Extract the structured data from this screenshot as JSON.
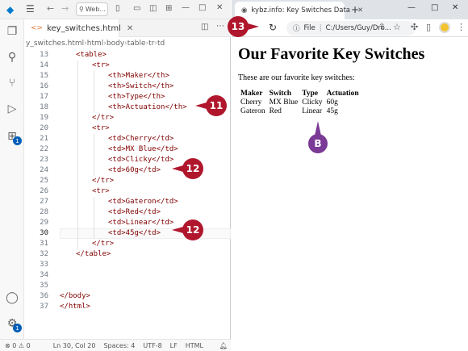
{
  "vscode": {
    "search_text": "Web...",
    "tab_label": "key_switches.html",
    "breadcrumb": [
      "y_switches.html",
      "html",
      "body",
      "table",
      "tr",
      "td"
    ],
    "lines": [
      {
        "n": "13",
        "text": "<table>",
        "indent": 1
      },
      {
        "n": "14",
        "text": "<tr>",
        "indent": 2
      },
      {
        "n": "15",
        "text": "<th>Maker</th>",
        "indent": 3
      },
      {
        "n": "16",
        "text": "<th>Switch</th>",
        "indent": 3
      },
      {
        "n": "17",
        "text": "<th>Type</th>",
        "indent": 3
      },
      {
        "n": "18",
        "text": "<th>Actuation</th>",
        "indent": 3
      },
      {
        "n": "19",
        "text": "</tr>",
        "indent": 2
      },
      {
        "n": "20",
        "text": "<tr>",
        "indent": 2
      },
      {
        "n": "21",
        "text": "<td>Cherry</td>",
        "indent": 3
      },
      {
        "n": "22",
        "text": "<td>MX Blue</td>",
        "indent": 3
      },
      {
        "n": "23",
        "text": "<td>Clicky</td>",
        "indent": 3
      },
      {
        "n": "24",
        "text": "<td>60g</td>",
        "indent": 3
      },
      {
        "n": "25",
        "text": "</tr>",
        "indent": 2
      },
      {
        "n": "26",
        "text": "<tr>",
        "indent": 2
      },
      {
        "n": "27",
        "text": "<td>Gateron</td>",
        "indent": 3
      },
      {
        "n": "28",
        "text": "<td>Red</td>",
        "indent": 3
      },
      {
        "n": "29",
        "text": "<td>Linear</td>",
        "indent": 3
      },
      {
        "n": "30",
        "text": "<td>45g</td>",
        "indent": 3
      },
      {
        "n": "31",
        "text": "</tr>",
        "indent": 2
      },
      {
        "n": "32",
        "text": "</table>",
        "indent": 1
      },
      {
        "n": "33",
        "text": "",
        "indent": 0
      },
      {
        "n": "34",
        "text": "",
        "indent": 0
      },
      {
        "n": "35",
        "text": "",
        "indent": 0
      },
      {
        "n": "36",
        "text": "</body>",
        "indent": 0
      },
      {
        "n": "37",
        "text": "</html>",
        "indent": 0
      }
    ],
    "status": {
      "errors": "0",
      "warnings": "0",
      "position": "Ln 30, Col 20",
      "spaces": "Spaces: 4",
      "encoding": "UTF-8",
      "eol": "LF",
      "language": "HTML"
    },
    "account_badge": "1",
    "extensions_badge": "1"
  },
  "browser": {
    "tab_title": "kybz.info: Key Switches Data",
    "address_prefix": "File",
    "address": "C:/Users/Guy/Dro...",
    "page": {
      "heading": "Our Favorite Key Switches",
      "intro": "These are our favorite key switches:",
      "table": {
        "headers": [
          "Maker",
          "Switch",
          "Type",
          "Actuation"
        ],
        "rows": [
          [
            "Cherry",
            "MX Blue",
            "Clicky",
            "60g"
          ],
          [
            "Gateron",
            "Red",
            "Linear",
            "45g"
          ]
        ]
      }
    }
  },
  "callouts": {
    "c11": "11",
    "c12a": "12",
    "c12b": "12",
    "c13": "13",
    "cB": "B"
  },
  "colors": {
    "callout_red": "#b0172d",
    "callout_purple": "#7b3a96",
    "tag_color": "#800000"
  }
}
